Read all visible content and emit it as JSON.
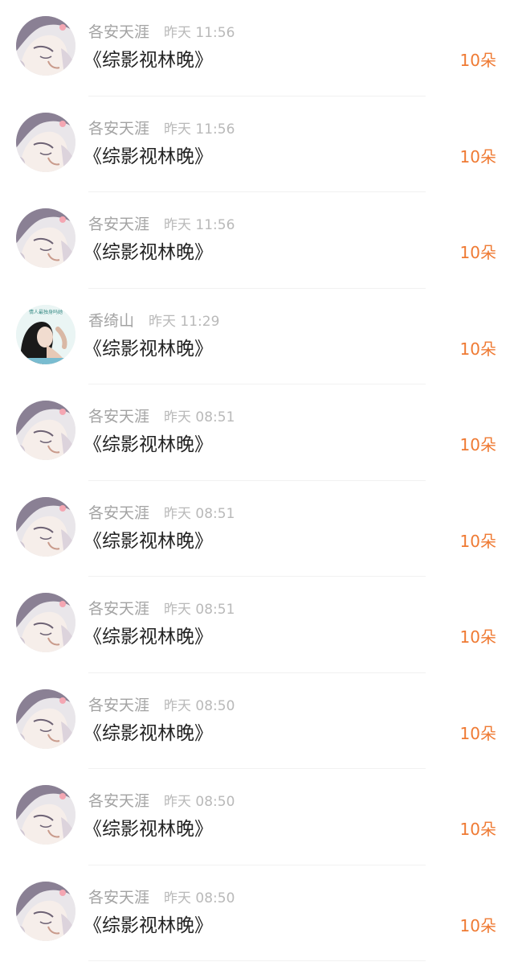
{
  "gifts": [
    {
      "user": "各安天涯",
      "time": "昨天 11:56",
      "title": "《综影视林晚》",
      "amount": "10朵",
      "avatar": "anime-girl"
    },
    {
      "user": "各安天涯",
      "time": "昨天 11:56",
      "title": "《综影视林晚》",
      "amount": "10朵",
      "avatar": "anime-girl"
    },
    {
      "user": "各安天涯",
      "time": "昨天 11:56",
      "title": "《综影视林晚》",
      "amount": "10朵",
      "avatar": "anime-girl"
    },
    {
      "user": "香绮山",
      "time": "昨天 11:29",
      "title": "《综影视林晚》",
      "amount": "10朵",
      "avatar": "photo-girl",
      "avatar_caption": "情人最独身吗她"
    },
    {
      "user": "各安天涯",
      "time": "昨天 08:51",
      "title": "《综影视林晚》",
      "amount": "10朵",
      "avatar": "anime-girl"
    },
    {
      "user": "各安天涯",
      "time": "昨天 08:51",
      "title": "《综影视林晚》",
      "amount": "10朵",
      "avatar": "anime-girl"
    },
    {
      "user": "各安天涯",
      "time": "昨天 08:51",
      "title": "《综影视林晚》",
      "amount": "10朵",
      "avatar": "anime-girl"
    },
    {
      "user": "各安天涯",
      "time": "昨天 08:50",
      "title": "《综影视林晚》",
      "amount": "10朵",
      "avatar": "anime-girl"
    },
    {
      "user": "各安天涯",
      "time": "昨天 08:50",
      "title": "《综影视林晚》",
      "amount": "10朵",
      "avatar": "anime-girl"
    },
    {
      "user": "各安天涯",
      "time": "昨天 08:50",
      "title": "《综影视林晚》",
      "amount": "10朵",
      "avatar": "anime-girl"
    }
  ],
  "colors": {
    "amount": "#ef7a33",
    "username": "#a3a3a3",
    "timestamp": "#b9b9b9",
    "title": "#222222"
  }
}
